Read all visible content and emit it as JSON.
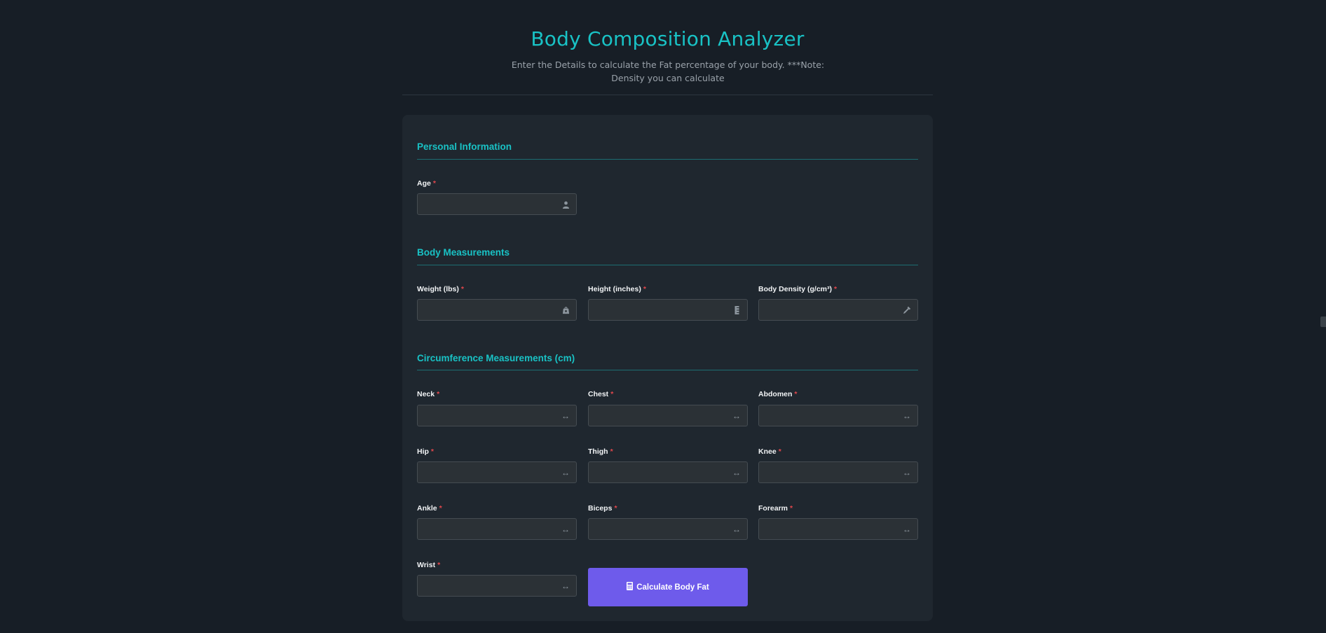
{
  "header": {
    "title": "Body Composition Analyzer",
    "subtitle": "Enter the Details to calculate the Fat percentage of your body. ***Note: Density you can calculate"
  },
  "sections": {
    "personal": {
      "title": "Personal Information"
    },
    "body": {
      "title": "Body Measurements"
    },
    "circumference": {
      "title": "Circumference Measurements (cm)"
    }
  },
  "required_marker": "*",
  "fields": {
    "age": {
      "label": "Age",
      "value": "",
      "icon": "user-icon"
    },
    "weight": {
      "label": "Weight (lbs)",
      "value": "",
      "icon": "weight-icon"
    },
    "height": {
      "label": "Height (inches)",
      "value": "",
      "icon": "ruler-vertical-icon"
    },
    "density": {
      "label": "Body Density (g/cm³)",
      "value": "",
      "icon": "eyedropper-icon"
    },
    "neck": {
      "label": "Neck",
      "value": "",
      "icon": "arrows-horizontal-icon"
    },
    "chest": {
      "label": "Chest",
      "value": "",
      "icon": "arrows-horizontal-icon"
    },
    "abdomen": {
      "label": "Abdomen",
      "value": "",
      "icon": "arrows-horizontal-icon"
    },
    "hip": {
      "label": "Hip",
      "value": "",
      "icon": "arrows-horizontal-icon"
    },
    "thigh": {
      "label": "Thigh",
      "value": "",
      "icon": "arrows-horizontal-icon"
    },
    "knee": {
      "label": "Knee",
      "value": "",
      "icon": "arrows-horizontal-icon"
    },
    "ankle": {
      "label": "Ankle",
      "value": "",
      "icon": "arrows-horizontal-icon"
    },
    "biceps": {
      "label": "Biceps",
      "value": "",
      "icon": "arrows-horizontal-icon"
    },
    "forearm": {
      "label": "Forearm",
      "value": "",
      "icon": "arrows-horizontal-icon"
    },
    "wrist": {
      "label": "Wrist",
      "value": "",
      "icon": "arrows-horizontal-icon"
    }
  },
  "actions": {
    "calculate_label": "Calculate Body Fat",
    "calculate_icon": "calculator-icon"
  },
  "colors": {
    "accent": "#19c2c5",
    "button": "#6e5beb",
    "required": "#e0474c",
    "background": "#171e26",
    "card": "#1f272f"
  }
}
